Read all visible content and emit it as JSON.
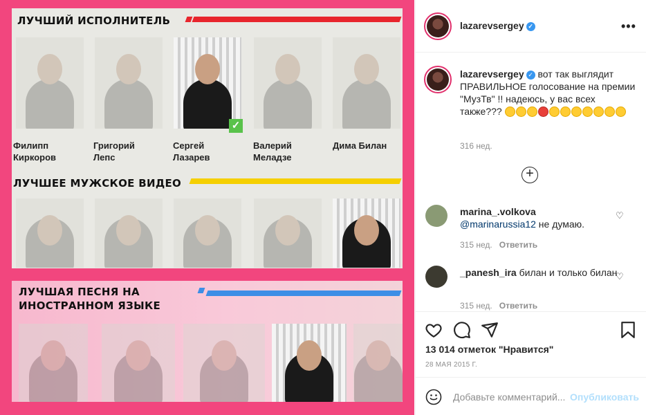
{
  "post": {
    "photo": {
      "categories": [
        {
          "title": "ЛУЧШИЙ ИСПОЛНИТЕЛЬ",
          "stripe_color": "#e8252d"
        },
        {
          "title": "ЛУЧШЕЕ МУЖСКОЕ ВИДЕО",
          "stripe_color": "#f5cf00"
        },
        {
          "title_line1": "ЛУЧШАЯ ПЕСНЯ НА",
          "title_line2": "ИНОСТРАННОМ ЯЗЫКЕ",
          "stripe_color": "#3d8ee6"
        }
      ],
      "nominees": [
        {
          "line1": "Филипп",
          "line2": "Киркоров"
        },
        {
          "line1": "Григорий",
          "line2": "Лепс"
        },
        {
          "line1": "Сергей",
          "line2": "Лазарев"
        },
        {
          "line1": "Валерий",
          "line2": "Меладзе"
        },
        {
          "line1": "Дима Билан",
          "line2": ""
        }
      ],
      "check_mark": "✓",
      "frame_color": "#f2467e"
    },
    "header": {
      "username": "lazarevsergey",
      "verified_icon": "verified-badge-icon",
      "more_label": "•••"
    },
    "caption": {
      "username": "lazarevsergey",
      "text": "вот так выглядит ПРАВИЛЬНОЕ голосование на премии \"МузТв\" !! надеюсь, у вас всех также???",
      "time": "316 нед."
    },
    "load_more_icon": "+",
    "comments": [
      {
        "username": "marina_.volkova",
        "mention": "@marinarussia12",
        "text": " не думаю.",
        "time": "315 нед.",
        "reply_label": "Ответить"
      },
      {
        "username": "_panesh_ira",
        "mention": "",
        "text": " билан и только билан",
        "time": "315 нед.",
        "reply_label": "Ответить"
      }
    ],
    "likes": "13 014 отметок \"Нравится\"",
    "date": "28 МАЯ 2015 Г.",
    "composer": {
      "placeholder": "Добавьте комментарий...",
      "publish_label": "Опубликовать"
    },
    "colors": {
      "verified": "#3897f0",
      "link": "#00376b",
      "publish_disabled": "#b2dffc"
    }
  }
}
